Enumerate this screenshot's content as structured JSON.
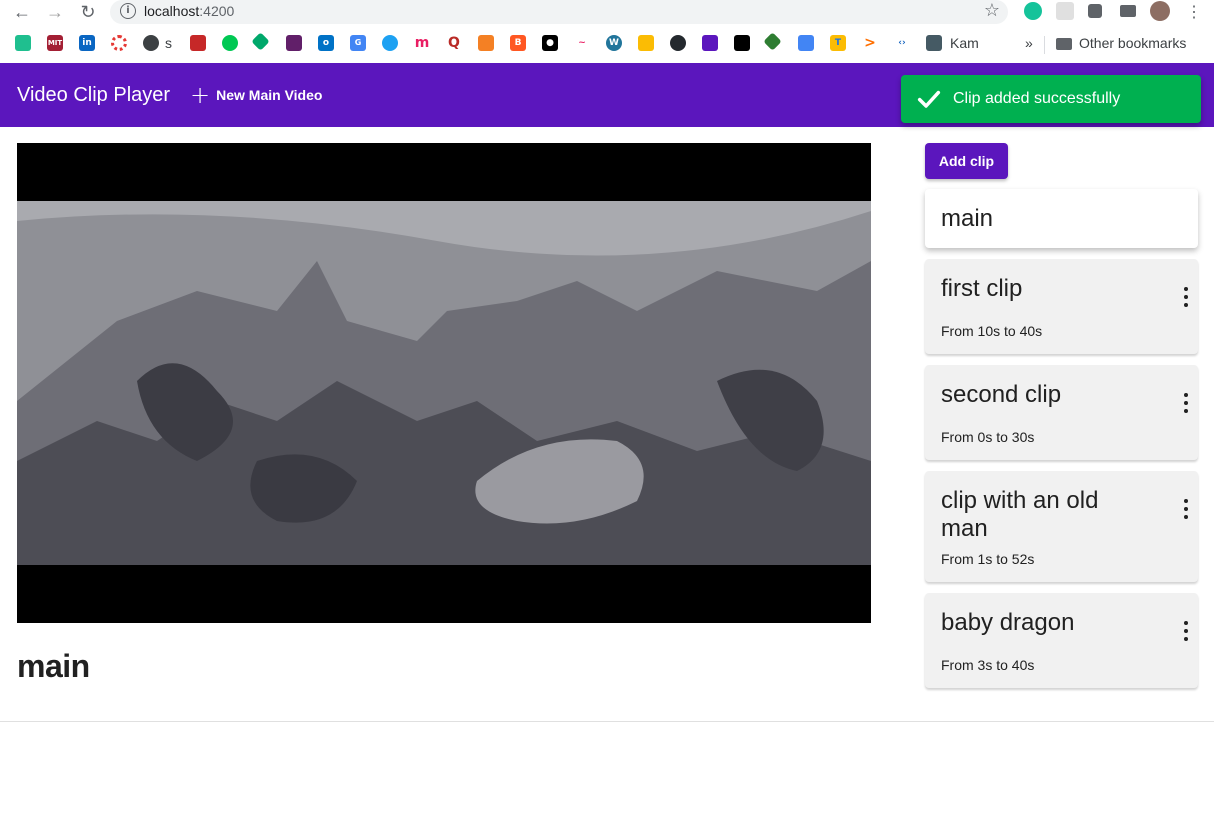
{
  "browser": {
    "url_host": "localhost",
    "url_port": ":4200",
    "bookmarks": {
      "kam_label": "Kam",
      "more_label": "»",
      "other_label": "Other bookmarks"
    },
    "bookmark_s_label": "s"
  },
  "app": {
    "title": "Video Clip Player",
    "new_video_label": "New Main Video",
    "snackbar": "Clip added successfully",
    "add_clip_label": "Add clip",
    "current_video_title": "main",
    "clips": [
      {
        "title": "main",
        "range": ""
      },
      {
        "title": "first clip",
        "range": "From 10s to 40s"
      },
      {
        "title": "second clip",
        "range": "From 0s to 30s"
      },
      {
        "title": "clip with an old man",
        "range": "From 1s to 52s"
      },
      {
        "title": "baby dragon",
        "range": "From 3s to 40s"
      }
    ]
  },
  "colors": {
    "primary": "#5b16bd",
    "success": "#00b050"
  }
}
